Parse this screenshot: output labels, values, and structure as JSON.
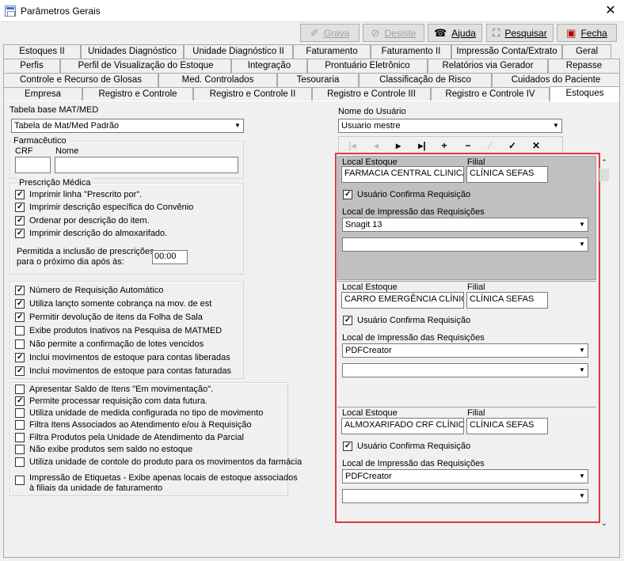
{
  "window": {
    "title": "Parâmetros Gerais",
    "close": "✕"
  },
  "toolbar": [
    {
      "id": "grava",
      "label": "Grava",
      "icon": "✐",
      "enabled": false
    },
    {
      "id": "desiste",
      "label": "Desiste",
      "icon": "⊘",
      "enabled": false
    },
    {
      "id": "ajuda",
      "label": "Ajuda",
      "icon": "☎",
      "enabled": true
    },
    {
      "id": "pesquisar",
      "label": "Pesquisar",
      "icon": "⛶",
      "enabled": true
    },
    {
      "id": "fecha",
      "label": "Fecha",
      "icon": "▣",
      "enabled": true
    }
  ],
  "tabs": {
    "row1": [
      "Estoques II",
      "Unidades Diagnóstico",
      "Unidade Diagnóstico II",
      "Faturamento",
      "Faturamento II",
      "Impressão Conta/Extrato",
      "Geral"
    ],
    "row2": [
      "Perfis",
      "Perfil de Visualização do Estoque",
      "Integração",
      "Prontuário Eletrônico",
      "Relatórios via Gerador",
      "Repasse"
    ],
    "row3": [
      "Controle e Recurso de Glosas",
      "Med. Controlados",
      "Tesouraria",
      "Classificação de Risco",
      "Cuidados do Paciente"
    ],
    "row4": [
      "Empresa",
      "Registro e Controle",
      "Registro e Controle II",
      "Registro e Controle III",
      "Registro e Controle IV",
      "Estoques"
    ],
    "active": "Estoques"
  },
  "left": {
    "tabela_label": "Tabela base MAT/MED",
    "tabela_value": "Tabela de Mat/Med Padrão",
    "farmaceutico": {
      "legend": "Farmacêutico",
      "crf_label": "CRF",
      "nome_label": "Nome",
      "crf": "",
      "nome": ""
    },
    "prescricao": {
      "legend": "Prescrição Médica",
      "items": [
        {
          "label": "Imprimir linha \"Prescrito por\".",
          "checked": true
        },
        {
          "label": "Imprimir descrição específica do Convênio",
          "checked": true
        },
        {
          "label": "Ordenar por descrição do item.",
          "checked": true
        },
        {
          "label": "Imprimir descrição do almoxarifado.",
          "checked": true
        }
      ],
      "permitida_label1": "Permitida a inclusão de prescrições",
      "permitida_label2": "para o próximo dia após às:",
      "hora": "00:00"
    },
    "group2": [
      {
        "label": "Número de Requisição Automático",
        "checked": true
      },
      {
        "label": "Utiliza lançto somente cobrança na mov. de est",
        "checked": true
      },
      {
        "label": "Permitir devolução de itens da Folha de Sala",
        "checked": true
      },
      {
        "label": "Exibe produtos Inativos na Pesquisa de MATMED",
        "checked": false
      },
      {
        "label": "Não permite a confirmação de lotes vencidos",
        "checked": false
      },
      {
        "label": "Inclui movimentos de estoque para contas liberadas",
        "checked": true
      },
      {
        "label": "Inclui movimentos de estoque para contas faturadas",
        "checked": true
      }
    ],
    "group3": [
      {
        "label": "Apresentar Saldo de Itens \"Em movimentação\".",
        "checked": false
      },
      {
        "label": "Permite processar requisição com data futura.",
        "checked": true
      },
      {
        "label": "Utiliza unidade de medida configurada no tipo de movimento",
        "checked": false
      },
      {
        "label": "Filtra Itens Associados ao Atendimento e/ou à Requisição",
        "checked": false
      },
      {
        "label": "Filtra Produtos pela Unidade de Atendimento da Parcial",
        "checked": false
      },
      {
        "label": "Não exibe produtos sem saldo no estoque",
        "checked": false
      },
      {
        "label": "Utiliza unidade de contole do produto para os movimentos da farmácia",
        "checked": false
      }
    ],
    "etiquetas": {
      "label1": "Impressão de Etiquetas - Exibe apenas locais de estoque associados",
      "label2": "à filiais da unidade de faturamento",
      "checked": false
    }
  },
  "right": {
    "usuario_label": "Nome do Usuário",
    "usuario_value": "Usuario mestre",
    "nav": [
      "|◂",
      "◂",
      "▸",
      "▸|",
      "+",
      "−",
      "⁄",
      "✓",
      "✕"
    ],
    "records": [
      {
        "local_label": "Local Estoque",
        "local": "FARMACIA CENTRAL CLINICA",
        "filial_label": "Filial",
        "filial": "CLÍNICA SEFAS",
        "confirma": "Usuário Confirma Requisição",
        "confirma_checked": true,
        "impressao_label": "Local de Impressão das Requisições",
        "impressora": "Snagit 13",
        "impressora2": ""
      },
      {
        "local_label": "Local Estoque",
        "local": "CARRO EMERGÊNCIA CLÍNICA",
        "filial_label": "Filial",
        "filial": "CLÍNICA SEFAS",
        "confirma": "Usuário Confirma Requisição",
        "confirma_checked": true,
        "impressao_label": "Local de Impressão das Requisições",
        "impressora": "PDFCreator",
        "impressora2": ""
      },
      {
        "local_label": "Local Estoque",
        "local": "ALMOXARIFADO CRF CLÍNICA",
        "filial_label": "Filial",
        "filial": "CLÍNICA SEFAS",
        "confirma": "Usuário Confirma Requisição",
        "confirma_checked": true,
        "impressao_label": "Local de Impressão das Requisições",
        "impressora": "PDFCreator",
        "impressora2": ""
      }
    ]
  },
  "colors": {
    "highlight": "#e0393e",
    "selected_record_bg": "#c0c0c0"
  }
}
